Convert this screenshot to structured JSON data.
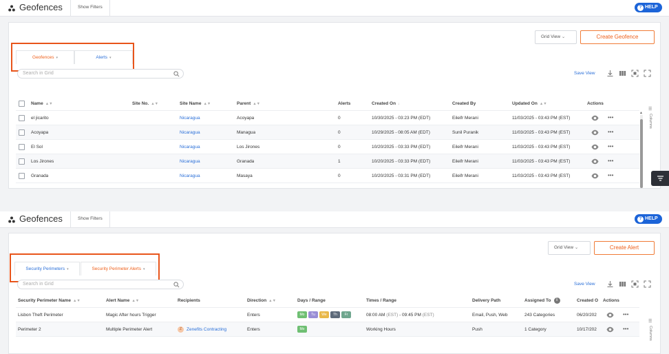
{
  "top": {
    "app_title": "Geofences",
    "show_filters": "Show Filters",
    "help": "HELP",
    "grid_view": "Grid View",
    "create_label": "Create Geofence",
    "tabs": [
      "Geofences",
      "Alerts"
    ],
    "search_placeholder": "Search in Grid",
    "save_view": "Save View",
    "columns_label": "Columns",
    "headers": [
      "Name",
      "Site No.",
      "Site Name",
      "Parent",
      "Alerts",
      "Created On",
      "Created By",
      "Updated On",
      "Actions"
    ],
    "rows": [
      [
        "el jicarito",
        "",
        "Nicaragua",
        "Acoyapa",
        "0",
        "10/30/2025 - 03:23 PM (EDT)",
        "Eileifr Merani",
        "11/03/2025 - 03:43 PM (EST)"
      ],
      [
        "Acoyapa",
        "",
        "Nicaragua",
        "Managua",
        "0",
        "10/29/2025 - 08:05 AM (EDT)",
        "Sunil Puranik",
        "11/03/2025 - 03:43 PM (EST)"
      ],
      [
        "El Sol",
        "",
        "Nicaragua",
        "Los Jirones",
        "0",
        "10/20/2025 - 03:33 PM (EDT)",
        "Eileifr Merani",
        "11/03/2025 - 03:43 PM (EST)"
      ],
      [
        "Los Jirones",
        "",
        "Nicaragua",
        "Granada",
        "1",
        "10/20/2025 - 03:33 PM (EDT)",
        "Eileifr Merani",
        "11/03/2025 - 03:43 PM (EST)"
      ],
      [
        "Granada",
        "",
        "Nicaragua",
        "Masaya",
        "0",
        "10/20/2025 - 03:31 PM (EDT)",
        "Eileifr Merani",
        "11/03/2025 - 03:43 PM (EST)"
      ]
    ]
  },
  "bottom": {
    "app_title": "Geofences",
    "show_filters": "Show Filters",
    "help": "HELP",
    "grid_view": "Grid View",
    "create_label": "Create Alert",
    "tabs": [
      "Security Perimeters",
      "Security Perimeter Alerts"
    ],
    "search_placeholder": "Search in Grid",
    "save_view": "Save View",
    "columns_label": "Columns",
    "headers": [
      "Security Perimeter Name",
      "Alert Name",
      "Recipients",
      "Direction",
      "Days / Range",
      "Times / Range",
      "Delivery Path",
      "Assigned To",
      "Created O",
      "Actions"
    ],
    "rows": [
      {
        "name": "Lisbon Theft Perimeter",
        "alert": "Magic After hours Trigger",
        "recipient": "",
        "avatar": "",
        "direction": "Enters",
        "days": [
          "Mo",
          "Tu",
          "We",
          "Th",
          "Fr"
        ],
        "time_start": "08:00 AM",
        "time_start_tz": "(EST)",
        "time_sep": " - ",
        "time_end": "09:45 PM",
        "time_end_tz": "(EST)",
        "delivery": "Email, Push, Web",
        "assigned": "243 Categories",
        "created": "06/20/202"
      },
      {
        "name": "Perimeter 2",
        "alert": "Multiple Perimeter Alert",
        "recipient": "Zenefits Contracting",
        "avatar": "Z",
        "direction": "Enters",
        "days": [
          "Mo"
        ],
        "time_start": "Working Hours",
        "time_start_tz": "",
        "time_sep": "",
        "time_end": "",
        "time_end_tz": "",
        "delivery": "Push",
        "assigned": "1 Category",
        "created": "10/17/202"
      }
    ]
  },
  "colors": {
    "accent": "#ee5f1a",
    "link": "#2a6fd8",
    "help": "#1c64d8",
    "highlight": "#e8541a",
    "days": {
      "Mo": "#6fbf73",
      "Tu": "#9a8ed6",
      "We": "#e9b84a",
      "Th": "#5d6a7a",
      "Fr": "#6fa68e"
    }
  }
}
